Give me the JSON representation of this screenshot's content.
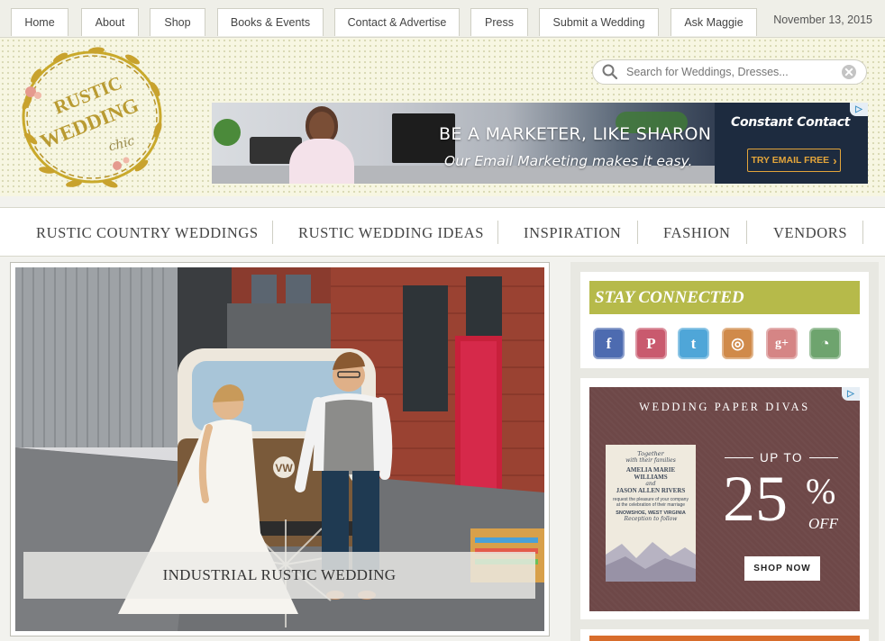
{
  "top_nav": {
    "tabs": [
      "Home",
      "About",
      "Shop",
      "Books & Events",
      "Contact & Advertise",
      "Press",
      "Submit a Wedding",
      "Ask Maggie"
    ],
    "date": "November 13, 2015"
  },
  "logo": {
    "line1": "RUSTIC",
    "line2": "WEDDING",
    "line3": "chic"
  },
  "search": {
    "placeholder": "Search for Weddings, Dresses..."
  },
  "ad_banner": {
    "headline": "BE A MARKETER, LIKE SHARON",
    "subline": "Our Email Marketing makes it easy.",
    "brand": "Constant Contact",
    "cta": "TRY EMAIL FREE"
  },
  "main_nav": {
    "items": [
      "RUSTIC COUNTRY WEDDINGS",
      "RUSTIC WEDDING IDEAS",
      "INSPIRATION",
      "FASHION",
      "VENDORS"
    ]
  },
  "featured": {
    "caption": "INDUSTRIAL RUSTIC WEDDING"
  },
  "sidebar": {
    "stay_connected": "STAY CONNECTED",
    "social_icons": [
      {
        "name": "facebook-icon",
        "glyph": "f",
        "color": "#4d6bb0"
      },
      {
        "name": "pinterest-icon",
        "glyph": "P",
        "color": "#c95a6e"
      },
      {
        "name": "twitter-icon",
        "glyph": "t",
        "color": "#4fa6d8"
      },
      {
        "name": "instagram-icon",
        "glyph": "◎",
        "color": "#d08a4a"
      },
      {
        "name": "google-plus-icon",
        "glyph": "g+",
        "color": "#d58585"
      },
      {
        "name": "rss-icon",
        "glyph": "◔",
        "color": "#6ea46e"
      }
    ],
    "wpd_ad": {
      "brand": "WEDDING PAPER DIVAS",
      "up_to": "UP TO",
      "percent": "25",
      "percent_sign": "%",
      "off": "OFF",
      "cta": "SHOP NOW",
      "card": {
        "line1": "Together",
        "line2": "with their families",
        "name1": "AMELIA MARIE WILLIAMS",
        "and": "and",
        "name2": "JASON ALLEN RIVERS",
        "line3": "request the pleasure of your company",
        "line4": "at the celebration of their marriage",
        "place": "SNOWSHOE, WEST VIRGINIA",
        "reception": "Reception to follow"
      }
    }
  }
}
